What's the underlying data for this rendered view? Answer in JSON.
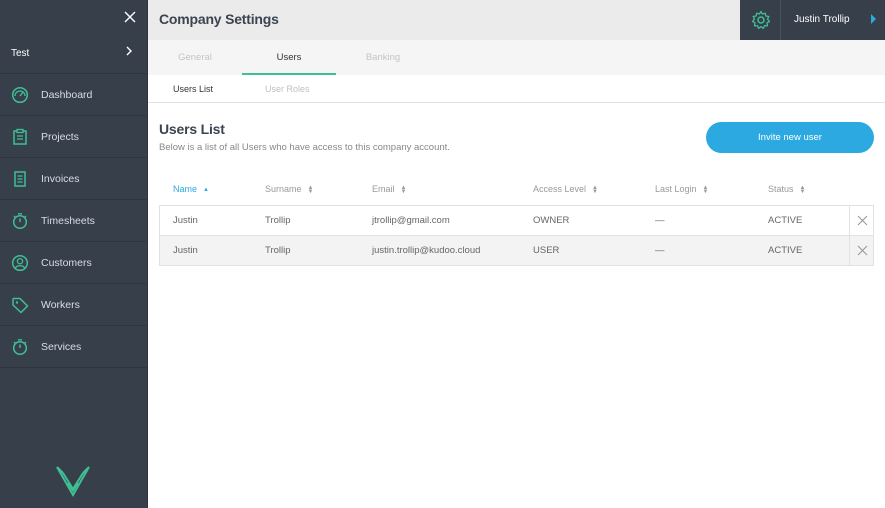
{
  "sidebar": {
    "close_icon": "close-icon",
    "company": "Test",
    "items": [
      {
        "label": "Dashboard",
        "icon": "dashboard-icon"
      },
      {
        "label": "Projects",
        "icon": "clipboard-icon"
      },
      {
        "label": "Invoices",
        "icon": "invoice-icon"
      },
      {
        "label": "Timesheets",
        "icon": "stopwatch-icon"
      },
      {
        "label": "Customers",
        "icon": "user-circle-icon"
      },
      {
        "label": "Workers",
        "icon": "tag-icon"
      },
      {
        "label": "Services",
        "icon": "stopwatch-icon"
      }
    ]
  },
  "header": {
    "title": "Company Settings",
    "user_name": "Justin Trollip"
  },
  "tabs": [
    {
      "label": "General",
      "active": false
    },
    {
      "label": "Users",
      "active": true
    },
    {
      "label": "Banking",
      "active": false
    }
  ],
  "subtabs": [
    {
      "label": "Users List",
      "active": true
    },
    {
      "label": "User Roles",
      "active": false
    }
  ],
  "main": {
    "title": "Users List",
    "description": "Below is a list of all Users who have access to this company account.",
    "invite_label": "Invite new user",
    "columns": [
      "Name",
      "Surname",
      "Email",
      "Access Level",
      "Last Login",
      "Status"
    ],
    "sorted_column": "Name",
    "rows": [
      {
        "name": "Justin",
        "surname": "Trollip",
        "email": "jtrollip@gmail.com",
        "access": "OWNER",
        "last_login": "—",
        "status": "ACTIVE"
      },
      {
        "name": "Justin",
        "surname": "Trollip",
        "email": "justin.trollip@kudoo.cloud",
        "access": "USER",
        "last_login": "—",
        "status": "ACTIVE"
      }
    ]
  },
  "colors": {
    "sidebar_bg": "#373f4b",
    "accent_green": "#3fbf94",
    "accent_blue": "#2ca9e1"
  }
}
